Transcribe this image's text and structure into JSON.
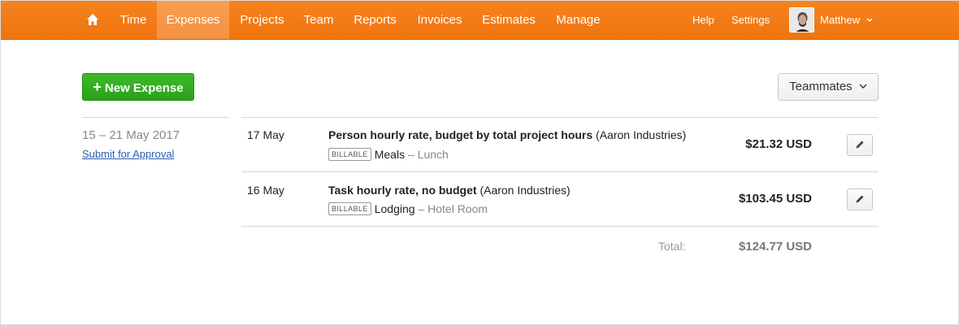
{
  "nav": {
    "items": [
      {
        "label": "Time",
        "active": false
      },
      {
        "label": "Expenses",
        "active": true
      },
      {
        "label": "Projects",
        "active": false
      },
      {
        "label": "Team",
        "active": false
      },
      {
        "label": "Reports",
        "active": false
      },
      {
        "label": "Invoices",
        "active": false
      },
      {
        "label": "Estimates",
        "active": false
      },
      {
        "label": "Manage",
        "active": false
      }
    ],
    "help": "Help",
    "settings": "Settings",
    "user": "Matthew",
    "accent_color": "#f37a18"
  },
  "toolbar": {
    "new_expense_label": "New Expense",
    "teammates_label": "Teammates"
  },
  "week": {
    "range": "15 – 21 May 2017",
    "submit_label": "Submit for Approval"
  },
  "expenses": [
    {
      "date": "17 May",
      "project": "Person hourly rate, budget by total project hours",
      "client": "(Aaron Industries)",
      "badge": "BILLABLE",
      "category": "Meals",
      "subcategory": "– Lunch",
      "amount": "$21.32 USD"
    },
    {
      "date": "16 May",
      "project": "Task hourly rate, no budget",
      "client": "(Aaron Industries)",
      "badge": "BILLABLE",
      "category": "Lodging",
      "subcategory": "– Hotel Room",
      "amount": "$103.45 USD"
    }
  ],
  "total": {
    "label": "Total:",
    "amount": "$124.77 USD"
  }
}
